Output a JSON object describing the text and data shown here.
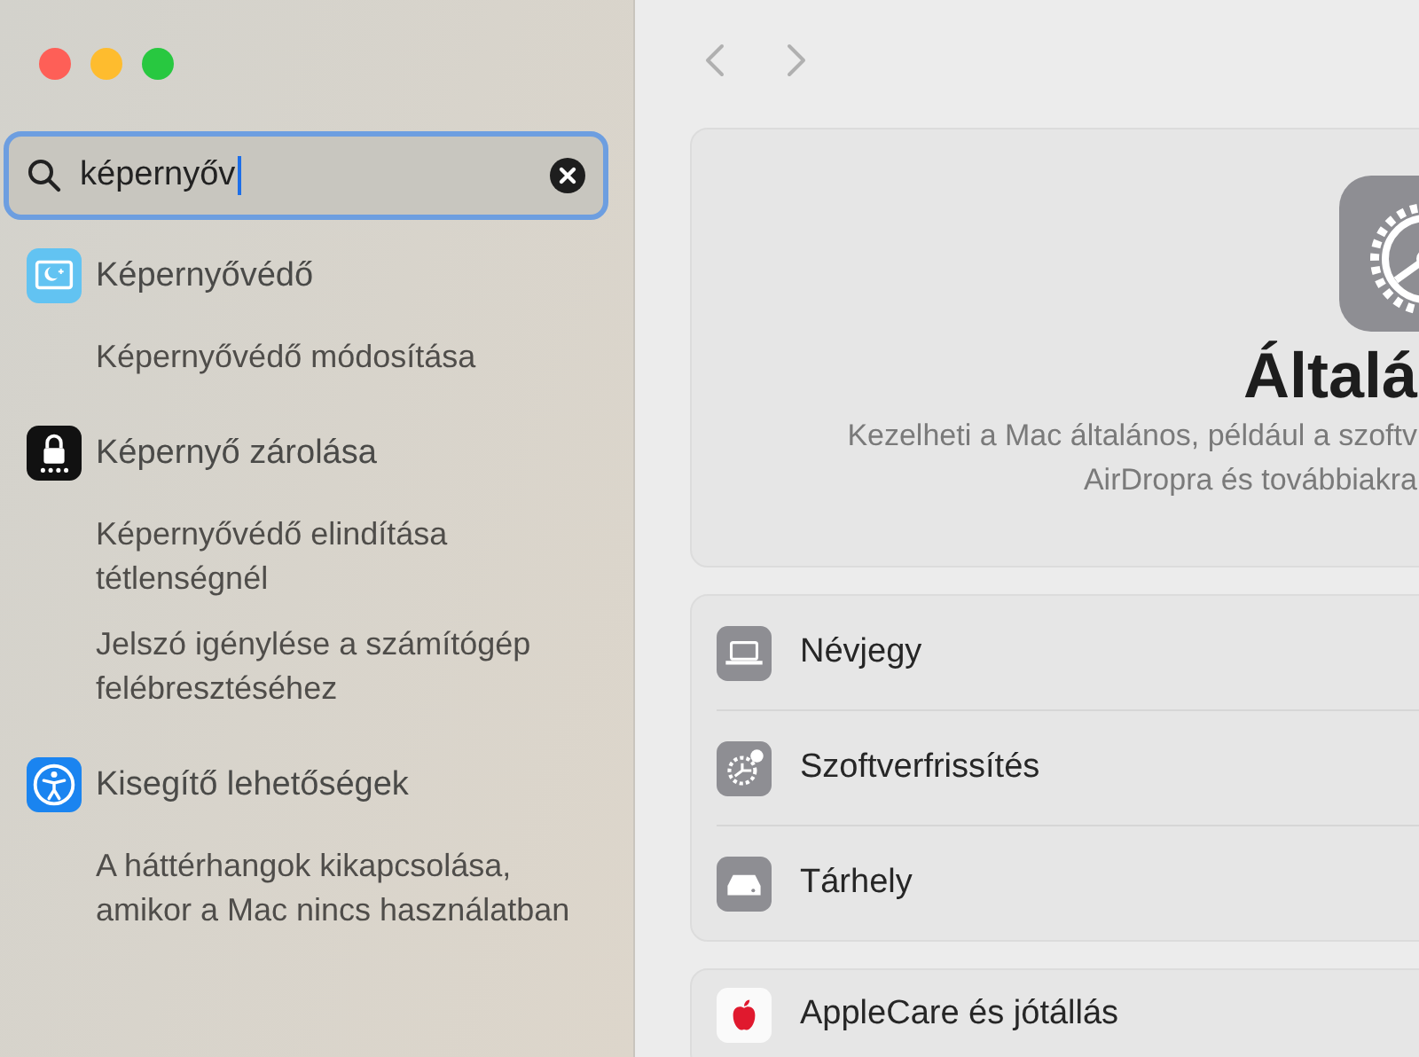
{
  "search": {
    "value": "képernyőv",
    "focused": true
  },
  "results": [
    {
      "title": "Képernyővédő",
      "kind": "screensaver",
      "items": [
        "Képernyővédő módosítása"
      ]
    },
    {
      "title": "Képernyő zárolása",
      "kind": "lock",
      "items": [
        "Képernyővédő elindítása tétlenségnél",
        "Jelszó igénylése a számítógép felébresztéséhez"
      ]
    },
    {
      "title": "Kisegítő lehetőségek",
      "kind": "accessibility",
      "items": [
        "A háttérhangok kikapcsolása, amikor a Mac nincs használatban"
      ]
    }
  ],
  "hero": {
    "title": "Általá",
    "lines": [
      "Kezelheti a Mac általános, például a szoftv",
      "AirDropra és továbbiakra"
    ]
  },
  "groups": [
    [
      {
        "label": "Névjegy",
        "kind": "laptop"
      },
      {
        "label": "Szoftverfrissítés",
        "kind": "gear"
      },
      {
        "label": "Tárhely",
        "kind": "drive"
      }
    ],
    [
      {
        "label": "AppleCare és jótállás",
        "kind": "apple"
      }
    ]
  ]
}
